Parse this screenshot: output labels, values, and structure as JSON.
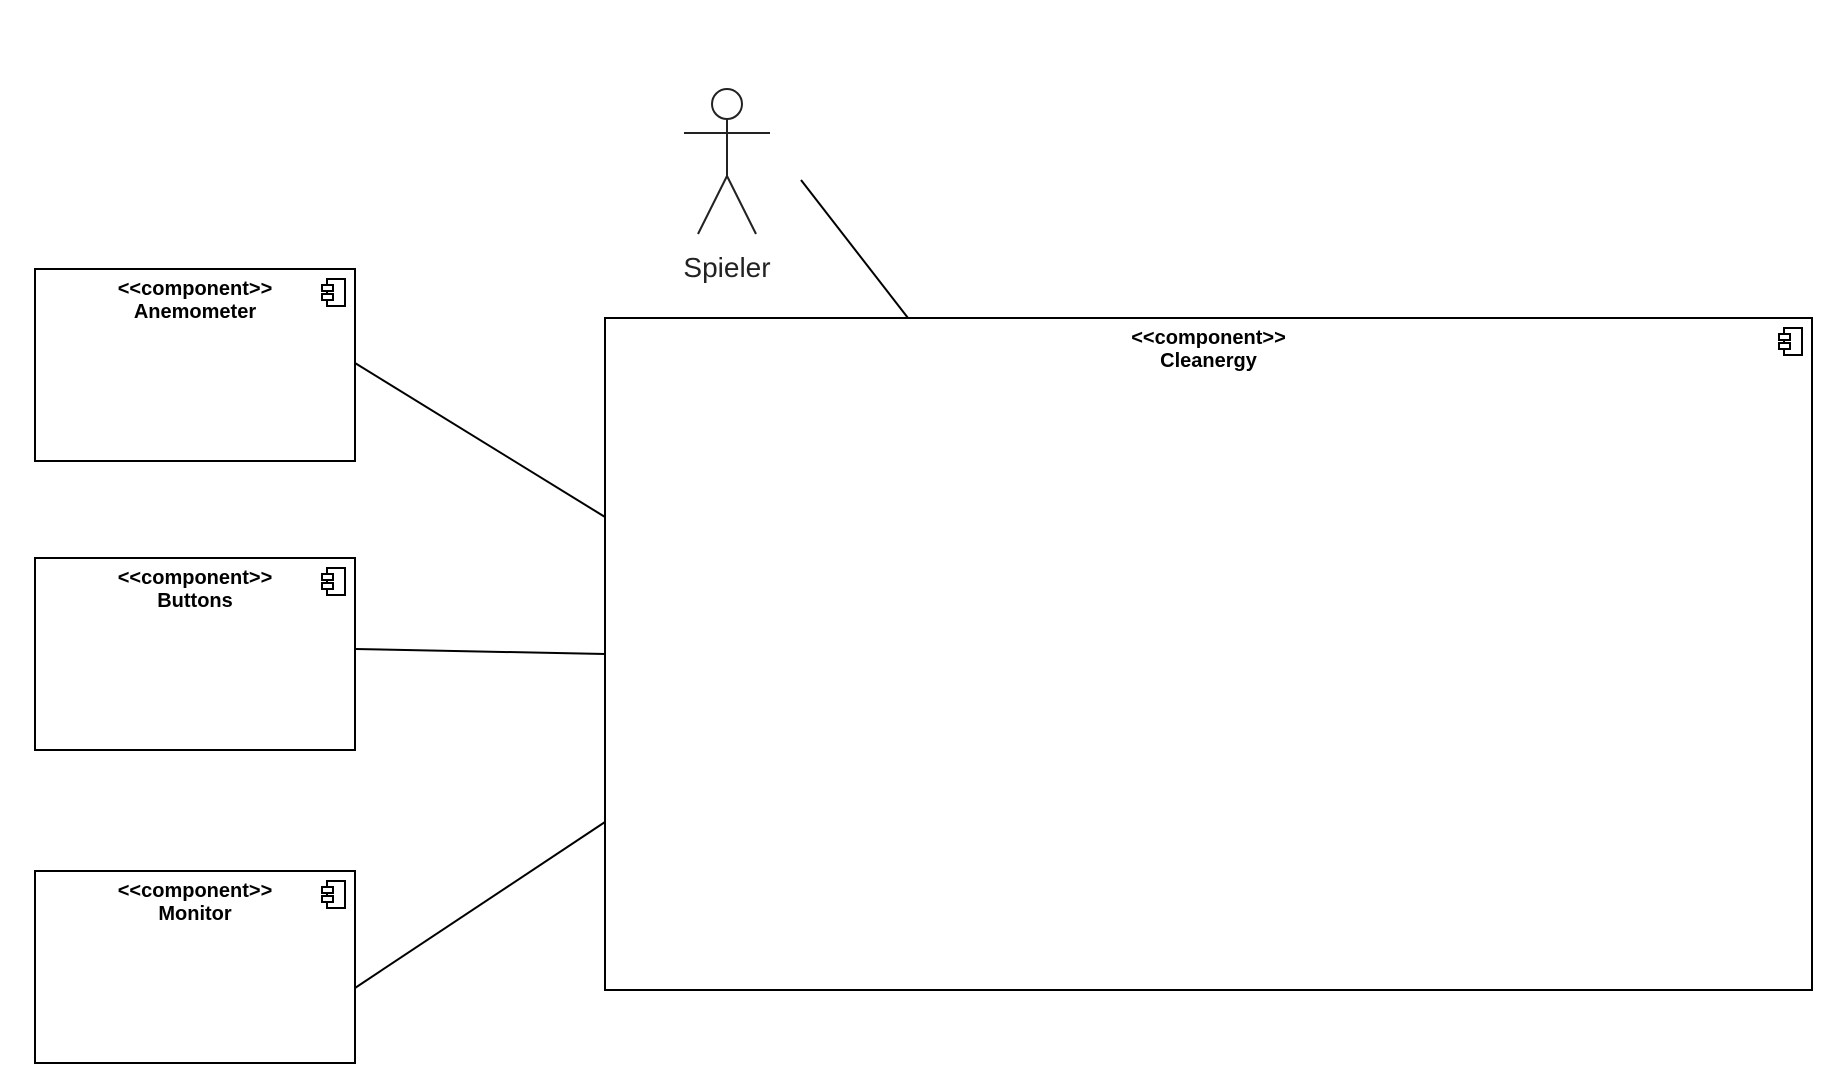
{
  "diagram": {
    "components": [
      {
        "id": "anemometer",
        "stereotype": "<<component>>",
        "name": "Anemometer",
        "icon": "component-icon"
      },
      {
        "id": "buttons",
        "stereotype": "<<component>>",
        "name": "Buttons",
        "icon": "component-icon"
      },
      {
        "id": "monitor",
        "stereotype": "<<component>>",
        "name": "Monitor",
        "icon": "component-icon"
      },
      {
        "id": "cleanergy",
        "stereotype": "<<component>>",
        "name": "Cleanergy",
        "icon": "component-icon"
      }
    ],
    "actor": {
      "name": "Spieler",
      "icon": "actor-icon"
    },
    "connections": [
      {
        "from": "anemometer",
        "to": "cleanergy"
      },
      {
        "from": "buttons",
        "to": "cleanergy"
      },
      {
        "from": "monitor",
        "to": "cleanergy"
      },
      {
        "from": "actor",
        "to": "cleanergy"
      }
    ],
    "colors": {
      "stroke": "#000000",
      "background": "#ffffff",
      "actor_text": "#222222"
    }
  }
}
